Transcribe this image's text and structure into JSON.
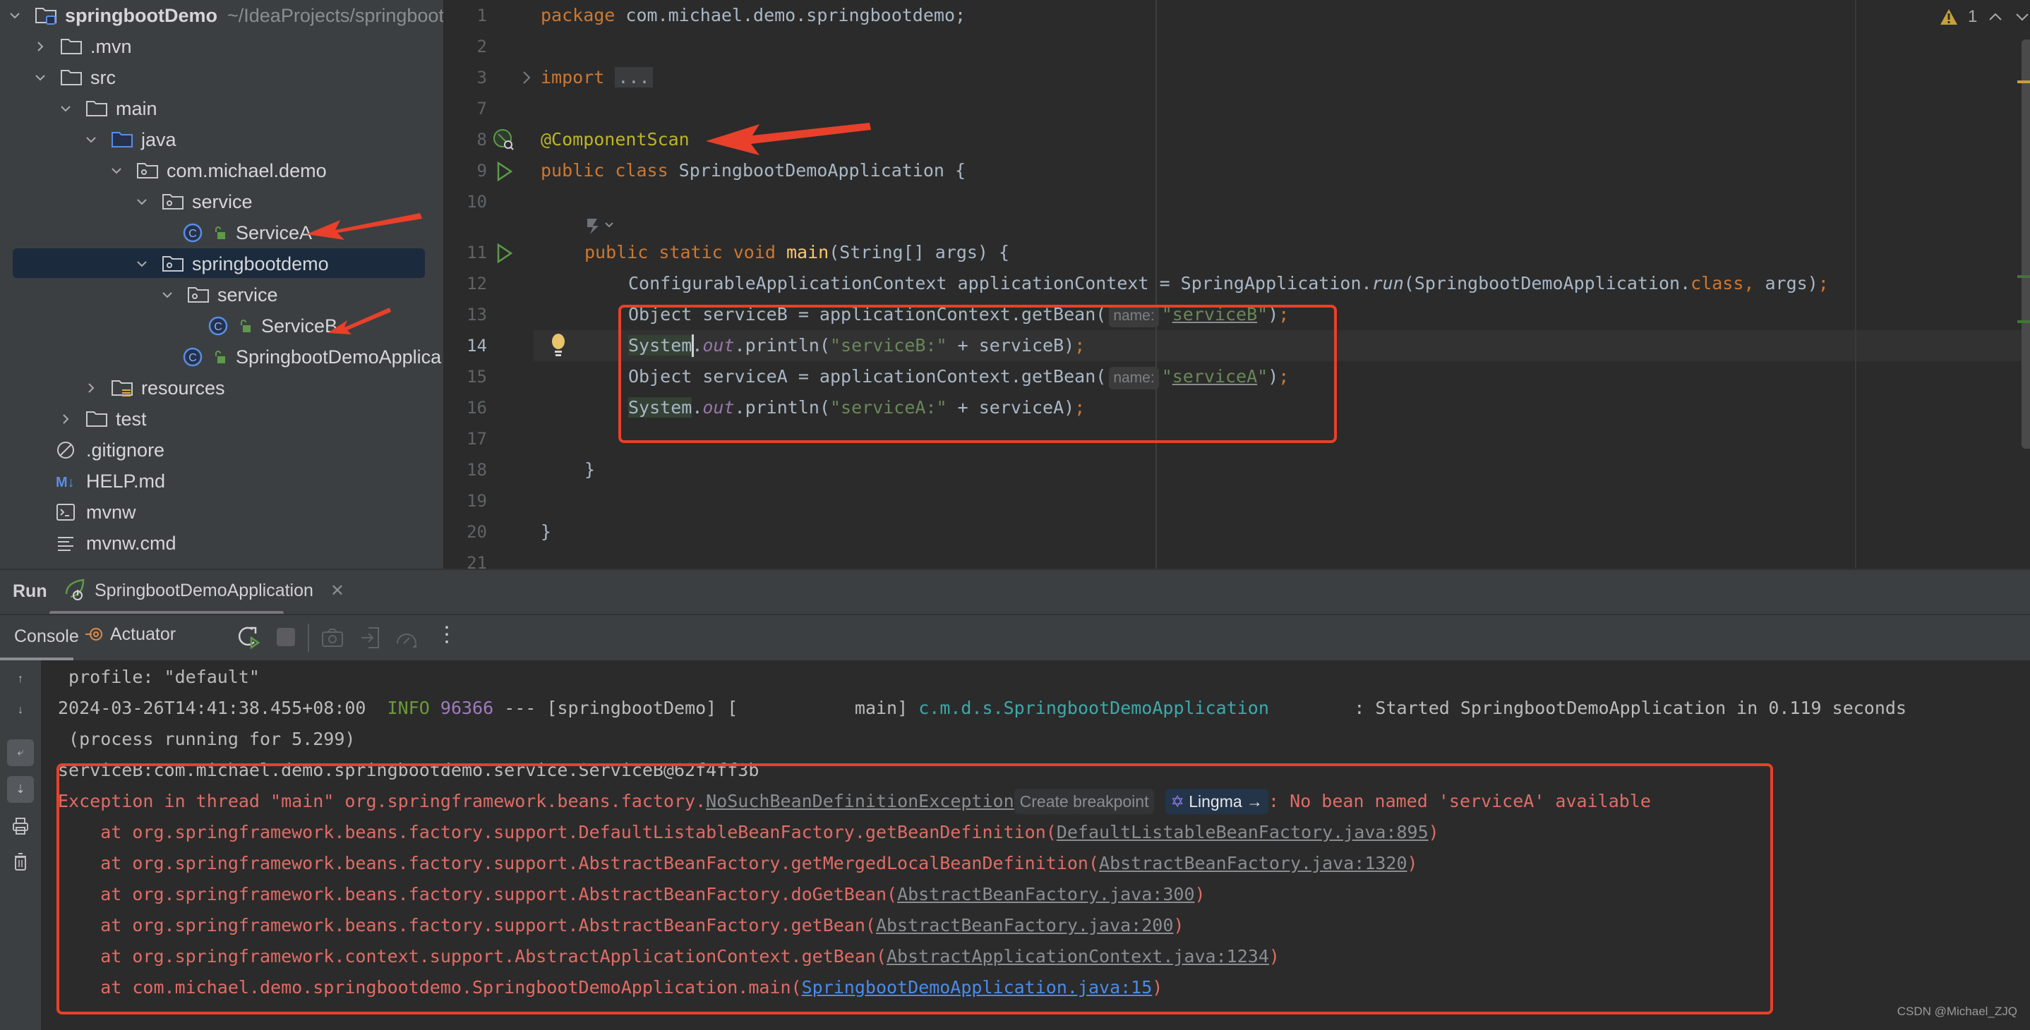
{
  "project_tree": {
    "root": {
      "label": "springbootDemo",
      "path": "~/IdeaProjects/springboot"
    },
    "items": [
      {
        "label": ".mvn"
      },
      {
        "label": "src"
      },
      {
        "label": "main"
      },
      {
        "label": "java"
      },
      {
        "label": "com.michael.demo"
      },
      {
        "label": "service"
      },
      {
        "label": "ServiceA"
      },
      {
        "label": "springbootdemo"
      },
      {
        "label": "service"
      },
      {
        "label": "ServiceB"
      },
      {
        "label": "SpringbootDemoApplica"
      },
      {
        "label": "resources"
      },
      {
        "label": "test"
      },
      {
        "label": ".gitignore"
      },
      {
        "label": "HELP.md"
      },
      {
        "label": "mvnw"
      },
      {
        "label": "mvnw.cmd"
      }
    ]
  },
  "editor": {
    "inspections": {
      "warning_count": "1"
    },
    "line_numbers": [
      "1",
      "2",
      "3",
      "7",
      "8",
      "9",
      "10",
      "11",
      "12",
      "13",
      "14",
      "15",
      "16",
      "17",
      "18",
      "19",
      "20",
      "21"
    ],
    "lines": {
      "l1_kw": "package",
      "l1_rest": " com.michael.demo.springbootdemo;",
      "l3_kw": "import",
      "l3_fold": "...",
      "l8_ann": "@ComponentScan",
      "l9_kw": "public class",
      "l9_rest": " SpringbootDemoApplication {",
      "l11_kw": "public static void",
      "l11_fn": "main",
      "l11_rest": "(String[] args) {",
      "l12_a": "ConfigurableApplicationContext applicationContext = SpringApplication.",
      "l12_run": "run",
      "l12_b": "(SpringbootDemoApplication.",
      "l12_class": "class,",
      "l12_c": " args)",
      "l12_semi": ";",
      "l13_a": "Object serviceB = applicationContext.getBean(",
      "hint_name": "name:",
      "l13_str": "serviceB",
      "l14_sys": "System",
      "l14_out": "out",
      "l14_a": ".println(",
      "l14_str": "\"serviceB:\"",
      "l14_b": " + serviceB)",
      "l15_a": "Object serviceA = applicationContext.getBean(",
      "l15_str": "serviceA",
      "l16_str": "\"serviceA:\"",
      "l16_b": " + serviceA)",
      "close_method": "}",
      "close_class": "}"
    }
  },
  "run_panel": {
    "title": "Run",
    "tab_label": "SpringbootDemoApplication",
    "toolbar": {
      "console": "Console",
      "actuator": "Actuator"
    },
    "console": {
      "line1": " profile: \"default\"",
      "log_time": "2024-03-26T14:41:38.455+08:00",
      "log_level": "INFO",
      "log_pid": "96366",
      "log_mid": " --- [springbootDemo] [           main] ",
      "log_logger": "c.m.d.s.SpringbootDemoApplication",
      "log_msg": "        : Started SpringbootDemoApplication in 0.119 seconds",
      "line3": " (process running for 5.299)",
      "out_serviceB": "serviceB:com.michael.demo.springbootdemo.service.ServiceB@62f4ff3b",
      "exc_prefix": "Exception in thread \"main\" org.springframework.beans.factory.",
      "exc_class": "NoSuchBeanDefinitionException",
      "create_breakpoint": "Create breakpoint",
      "lingma": "Lingma →",
      "exc_msg": ": No bean named 'serviceA' available",
      "stack": [
        {
          "at": "    at org.springframework.beans.factory.support.DefaultListableBeanFactory.getBeanDefinition(",
          "src": "DefaultListableBeanFactory.java:895"
        },
        {
          "at": "    at org.springframework.beans.factory.support.AbstractBeanFactory.getMergedLocalBeanDefinition(",
          "src": "AbstractBeanFactory.java:1320"
        },
        {
          "at": "    at org.springframework.beans.factory.support.AbstractBeanFactory.doGetBean(",
          "src": "AbstractBeanFactory.java:300"
        },
        {
          "at": "    at org.springframework.beans.factory.support.AbstractBeanFactory.getBean(",
          "src": "AbstractBeanFactory.java:200"
        },
        {
          "at": "    at org.springframework.context.support.AbstractApplicationContext.getBean(",
          "src": "AbstractApplicationContext.java:1234"
        },
        {
          "at": "    at com.michael.demo.springbootdemo.SpringbootDemoApplication.main(",
          "src": "SpringbootDemoApplication.java:15"
        }
      ],
      "close_paren": ")"
    }
  },
  "watermark": "CSDN @Michael_ZJQ",
  "colors": {
    "annotation_red": "#e8402a",
    "error_text": "#e06c66",
    "link_blue": "#4a8be8"
  }
}
